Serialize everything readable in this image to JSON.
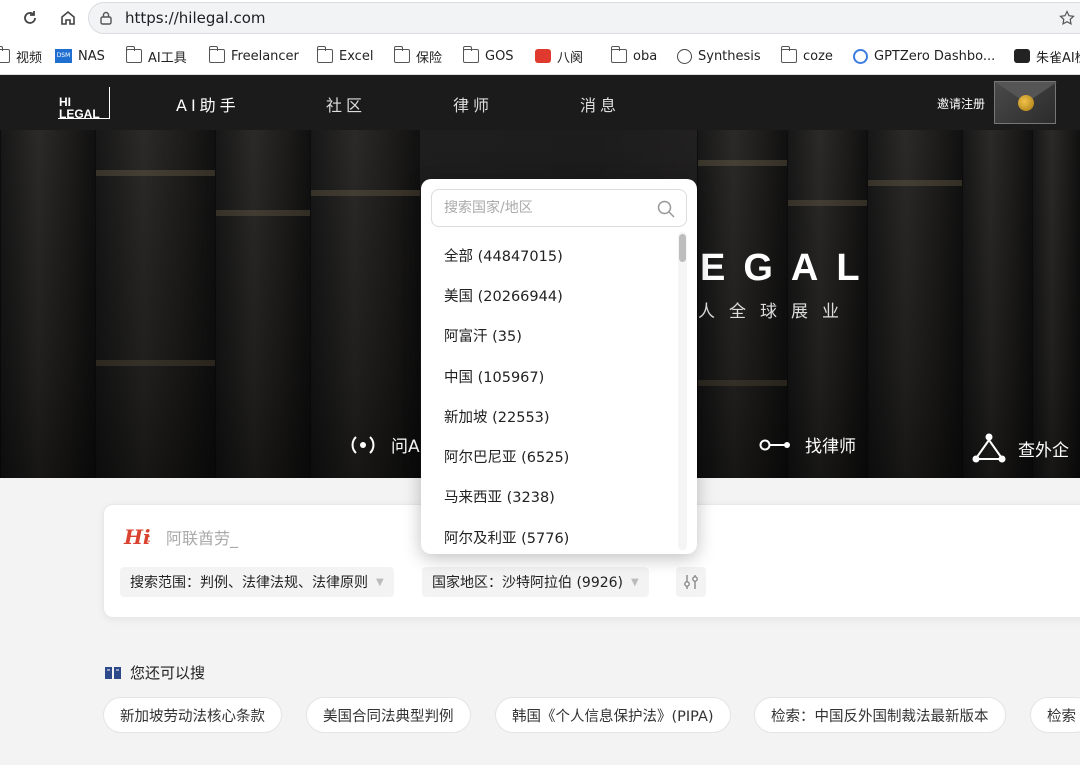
{
  "browser": {
    "url": "https://hilegal.com",
    "bookmarks": [
      {
        "label": "视频",
        "icon": "folder-icon"
      },
      {
        "label": "NAS",
        "icon": "dsm-icon"
      },
      {
        "label": "AI工具",
        "icon": "folder-icon"
      },
      {
        "label": "Freelancer",
        "icon": "folder-icon"
      },
      {
        "label": "Excel",
        "icon": "folder-icon"
      },
      {
        "label": "保险",
        "icon": "folder-icon"
      },
      {
        "label": "GOS",
        "icon": "folder-icon"
      },
      {
        "label": "八阕",
        "icon": "red-app-icon"
      },
      {
        "label": "oba",
        "icon": "folder-icon"
      },
      {
        "label": "Synthesis",
        "icon": "globe-icon"
      },
      {
        "label": "coze",
        "icon": "folder-icon"
      },
      {
        "label": "GPTZero Dashbo...",
        "icon": "gptzero-icon"
      },
      {
        "label": "朱雀AI检",
        "icon": "zhuque-icon"
      }
    ]
  },
  "header": {
    "logo_line1": "HI",
    "logo_line2": "LEGAL",
    "nav": [
      "AI助手",
      "社区",
      "律师",
      "消息"
    ],
    "invite": "邀请注册"
  },
  "hero": {
    "title": "EGAL",
    "subtitle": "人全球展业",
    "actions": [
      {
        "label": "问A",
        "icon": "broadcast-icon"
      },
      {
        "label": "找律师",
        "icon": "key-icon"
      },
      {
        "label": "查外企",
        "icon": "network-icon"
      }
    ]
  },
  "search": {
    "hi": "Hi",
    "colon": ":",
    "placeholder": "阿联酋劳_",
    "scope_label": "搜索范围：判例、法律法规、法律原则",
    "region_label": "国家地区：沙特阿拉伯 (9926)"
  },
  "dropdown": {
    "placeholder": "搜索国家/地区",
    "items": [
      "全部 (44847015)",
      "美国 (20266944)",
      "阿富汗 (35)",
      "中国 (105967)",
      "新加坡 (22553)",
      "阿尔巴尼亚 (6525)",
      "马来西亚 (3238)",
      "阿尔及利亚 (5776)"
    ]
  },
  "suggestions": {
    "title": "您还可以搜",
    "items": [
      "新加坡劳动法核心条款",
      "美国合同法典型判例",
      "韩国《个人信息保护法》(PIPA)",
      "检索：中国反外国制裁法最新版本",
      "检索"
    ]
  },
  "colors": {
    "accent_red": "#d9432f",
    "header_bg": "#1b1b1b"
  }
}
